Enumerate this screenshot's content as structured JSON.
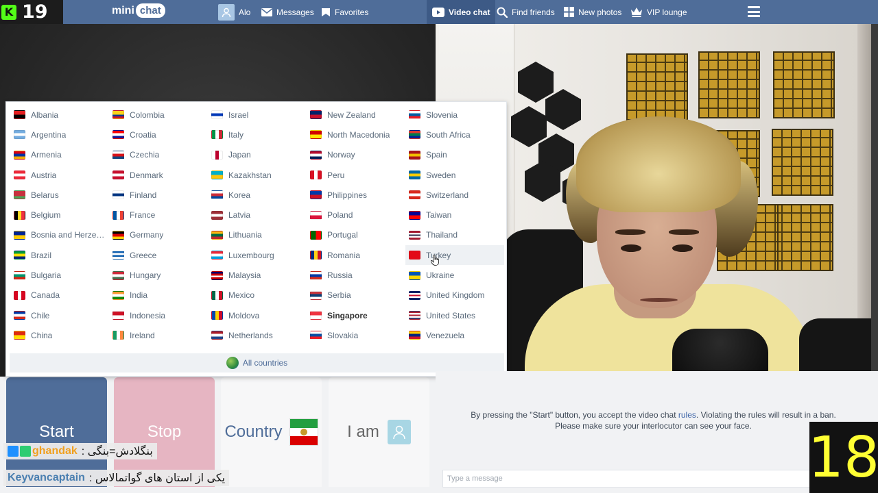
{
  "stream": {
    "viewer_count": "19",
    "age_overlay": "18",
    "chat": [
      {
        "user": "ghandak",
        "message": ": بنگلادش=بنگی"
      },
      {
        "user": "Keyvancaptain",
        "message": ": یکی از استان های گواتمالاس"
      }
    ]
  },
  "brand": {
    "mini": "mini",
    "chat": "chat"
  },
  "nav": {
    "alo": "Alo",
    "messages": "Messages",
    "favorites": "Favorites",
    "video_chat": "Video chat",
    "find_friends": "Find friends",
    "new_photos": "New photos",
    "vip_lounge": "VIP lounge"
  },
  "countries": [
    {
      "name": "Albania",
      "flag": [
        "#e41e20",
        "#000000"
      ]
    },
    {
      "name": "Argentina",
      "flag": [
        "#74acdf",
        "#ffffff",
        "#74acdf"
      ]
    },
    {
      "name": "Armenia",
      "flag": [
        "#d90012",
        "#0033a0",
        "#f2a800"
      ]
    },
    {
      "name": "Austria",
      "flag": [
        "#ed2939",
        "#ffffff",
        "#ed2939"
      ]
    },
    {
      "name": "Belarus",
      "flag": [
        "#c8313e",
        "#c8313e",
        "#4aa657"
      ]
    },
    {
      "name": "Belgium",
      "flag": [
        "#000000",
        "#fdda24",
        "#ef3340"
      ],
      "vertical": true
    },
    {
      "name": "Bosnia and Herzeg...",
      "flag": [
        "#002395",
        "#fecb00"
      ]
    },
    {
      "name": "Brazil",
      "flag": [
        "#009c3b",
        "#ffdf00",
        "#002776"
      ]
    },
    {
      "name": "Bulgaria",
      "flag": [
        "#ffffff",
        "#00966e",
        "#d62612"
      ]
    },
    {
      "name": "Canada",
      "flag": [
        "#d80621",
        "#ffffff",
        "#d80621"
      ],
      "vertical": true
    },
    {
      "name": "Chile",
      "flag": [
        "#0039a6",
        "#ffffff",
        "#d52b1e"
      ]
    },
    {
      "name": "China",
      "flag": [
        "#de2910",
        "#ffde00"
      ]
    },
    {
      "name": "Colombia",
      "flag": [
        "#fcd116",
        "#fcd116",
        "#003893",
        "#ce1126"
      ]
    },
    {
      "name": "Croatia",
      "flag": [
        "#ff0000",
        "#ffffff",
        "#171796"
      ]
    },
    {
      "name": "Czechia",
      "flag": [
        "#ffffff",
        "#d7141a",
        "#11457e"
      ]
    },
    {
      "name": "Denmark",
      "flag": [
        "#c8102e",
        "#ffffff",
        "#c8102e"
      ]
    },
    {
      "name": "Finland",
      "flag": [
        "#ffffff",
        "#003580",
        "#ffffff"
      ]
    },
    {
      "name": "France",
      "flag": [
        "#0055a4",
        "#ffffff",
        "#ef4135"
      ],
      "vertical": true
    },
    {
      "name": "Germany",
      "flag": [
        "#000000",
        "#dd0000",
        "#ffce00"
      ]
    },
    {
      "name": "Greece",
      "flag": [
        "#0d5eaf",
        "#ffffff",
        "#0d5eaf",
        "#ffffff"
      ]
    },
    {
      "name": "Hungary",
      "flag": [
        "#ce2939",
        "#ffffff",
        "#477050"
      ]
    },
    {
      "name": "India",
      "flag": [
        "#ff9933",
        "#ffffff",
        "#138808"
      ]
    },
    {
      "name": "Indonesia",
      "flag": [
        "#ce1126",
        "#ffffff"
      ]
    },
    {
      "name": "Ireland",
      "flag": [
        "#169b62",
        "#ffffff",
        "#ff883e"
      ],
      "vertical": true
    },
    {
      "name": "Israel",
      "flag": [
        "#ffffff",
        "#0038b8",
        "#ffffff"
      ]
    },
    {
      "name": "Italy",
      "flag": [
        "#009246",
        "#ffffff",
        "#ce2b37"
      ],
      "vertical": true
    },
    {
      "name": "Japan",
      "flag": [
        "#ffffff",
        "#bc002d",
        "#ffffff"
      ],
      "vertical": true
    },
    {
      "name": "Kazakhstan",
      "flag": [
        "#00afca",
        "#fec50c"
      ]
    },
    {
      "name": "Korea",
      "flag": [
        "#ffffff",
        "#cd2e3a",
        "#0047a0"
      ]
    },
    {
      "name": "Latvia",
      "flag": [
        "#9e3039",
        "#ffffff",
        "#9e3039"
      ]
    },
    {
      "name": "Lithuania",
      "flag": [
        "#fdb913",
        "#006a44",
        "#c1272d"
      ]
    },
    {
      "name": "Luxembourg",
      "flag": [
        "#ed2939",
        "#ffffff",
        "#00a1de"
      ]
    },
    {
      "name": "Malaysia",
      "flag": [
        "#010066",
        "#cc0001",
        "#ffffff",
        "#cc0001"
      ]
    },
    {
      "name": "Mexico",
      "flag": [
        "#006847",
        "#ffffff",
        "#ce1126"
      ],
      "vertical": true
    },
    {
      "name": "Moldova",
      "flag": [
        "#0046ae",
        "#ffd200",
        "#cc092f"
      ],
      "vertical": true
    },
    {
      "name": "Netherlands",
      "flag": [
        "#ae1c28",
        "#ffffff",
        "#21468b"
      ]
    },
    {
      "name": "New Zealand",
      "flag": [
        "#012169",
        "#c8102e"
      ]
    },
    {
      "name": "North Macedonia",
      "flag": [
        "#d20000",
        "#ffe600"
      ]
    },
    {
      "name": "Norway",
      "flag": [
        "#ba0c2f",
        "#ffffff",
        "#00205b"
      ]
    },
    {
      "name": "Peru",
      "flag": [
        "#d91023",
        "#ffffff",
        "#d91023"
      ],
      "vertical": true
    },
    {
      "name": "Philippines",
      "flag": [
        "#0038a8",
        "#ce1126"
      ]
    },
    {
      "name": "Poland",
      "flag": [
        "#ffffff",
        "#dc143c"
      ]
    },
    {
      "name": "Portugal",
      "flag": [
        "#006600",
        "#ff0000"
      ],
      "vertical": true
    },
    {
      "name": "Romania",
      "flag": [
        "#002b7f",
        "#fcd116",
        "#ce1126"
      ],
      "vertical": true
    },
    {
      "name": "Russia",
      "flag": [
        "#ffffff",
        "#0039a6",
        "#d52b1e"
      ]
    },
    {
      "name": "Serbia",
      "flag": [
        "#c6363c",
        "#0c4076",
        "#ffffff"
      ]
    },
    {
      "name": "Singapore",
      "flag": [
        "#ef3340",
        "#ffffff"
      ],
      "selected": true
    },
    {
      "name": "Slovakia",
      "flag": [
        "#ffffff",
        "#0b4ea2",
        "#ee1c25"
      ]
    },
    {
      "name": "Slovenia",
      "flag": [
        "#ffffff",
        "#005da4",
        "#ed1c24"
      ]
    },
    {
      "name": "South Africa",
      "flag": [
        "#de3831",
        "#007a4d",
        "#002395"
      ]
    },
    {
      "name": "Spain",
      "flag": [
        "#aa151b",
        "#f1bf00",
        "#aa151b"
      ]
    },
    {
      "name": "Sweden",
      "flag": [
        "#006aa7",
        "#fecc00",
        "#006aa7"
      ]
    },
    {
      "name": "Switzerland",
      "flag": [
        "#da291c",
        "#ffffff",
        "#da291c"
      ]
    },
    {
      "name": "Taiwan",
      "flag": [
        "#000095",
        "#fe0000"
      ]
    },
    {
      "name": "Thailand",
      "flag": [
        "#a51931",
        "#ffffff",
        "#2d2a4a",
        "#ffffff",
        "#a51931"
      ]
    },
    {
      "name": "Turkey",
      "flag": [
        "#e30a17",
        "#e30a17"
      ],
      "hovered": true
    },
    {
      "name": "Ukraine",
      "flag": [
        "#0057b7",
        "#ffd700"
      ]
    },
    {
      "name": "United Kingdom",
      "flag": [
        "#012169",
        "#ffffff",
        "#c8102e",
        "#ffffff",
        "#012169"
      ]
    },
    {
      "name": "United States",
      "flag": [
        "#b22234",
        "#ffffff",
        "#b22234",
        "#ffffff",
        "#3c3b6e"
      ]
    },
    {
      "name": "Venezuela",
      "flag": [
        "#ffcc00",
        "#00247d",
        "#cf142b"
      ]
    }
  ],
  "all_countries_label": "All countries",
  "controls": {
    "start": "Start",
    "stop": "Stop",
    "country": "Country",
    "i_am": "I am"
  },
  "notice": {
    "prefix": "By pressing the \"Start\" button, you accept the video chat ",
    "rules_link": "rules",
    "suffix": ". Violating the rules will result in a ban.",
    "line2": "Please make sure your interlocutor can see your face."
  },
  "message_input": {
    "placeholder": "Type a message"
  },
  "colors": {
    "brand_blue": "#4f6d99",
    "stop_pink": "#e6b5c2",
    "age_overlay_text": "#ffff33",
    "kick_green": "#53fc18"
  }
}
